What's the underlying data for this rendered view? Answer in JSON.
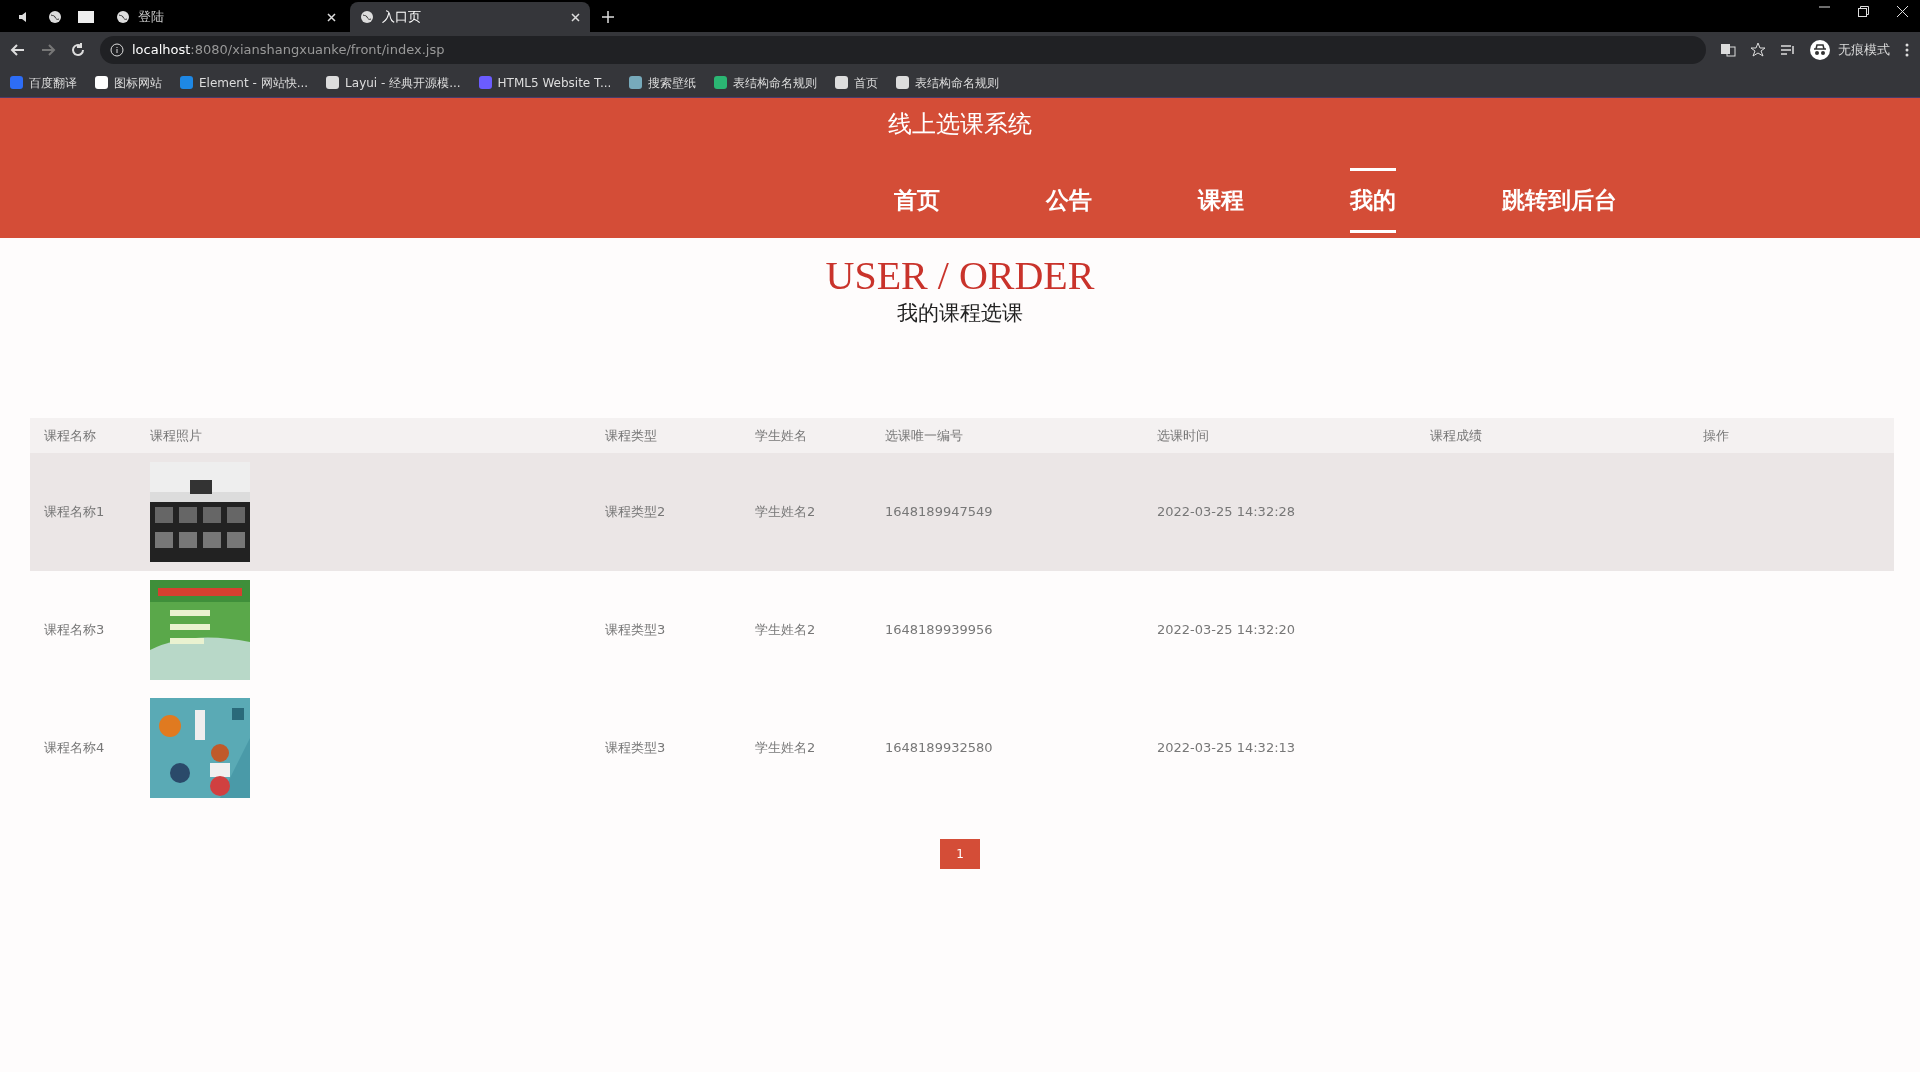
{
  "browser": {
    "tabs": [
      {
        "title": "登陆",
        "selected": false
      },
      {
        "title": "入口页",
        "selected": true
      }
    ],
    "url_host": "localhost",
    "url_path": ":8080/xianshangxuanke/front/index.jsp",
    "bookmarks": [
      "百度翻译",
      "图标网站",
      "Element - 网站快...",
      "Layui - 经典开源模...",
      "HTML5 Website T...",
      "搜索壁纸",
      "表结构命名规则",
      "首页",
      "表结构命名规则"
    ],
    "profile": "无痕模式"
  },
  "site": {
    "title": "线上选课系统",
    "nav": [
      {
        "label": "首页",
        "selected": false
      },
      {
        "label": "公告",
        "selected": false
      },
      {
        "label": "课程",
        "selected": false
      },
      {
        "label": "我的",
        "selected": true
      },
      {
        "label": "跳转到后台",
        "selected": false
      }
    ]
  },
  "page": {
    "title": "USER / ORDER",
    "subtitle": "我的课程选课"
  },
  "table": {
    "columns": [
      "课程名称",
      "课程照片",
      "课程类型",
      "学生姓名",
      "选课唯一编号",
      "选课时间",
      "课程成绩",
      "操作"
    ],
    "rows": [
      {
        "name": "课程名称1",
        "type": "课程类型2",
        "student": "学生姓名2",
        "number": "1648189947549",
        "time": "2022-03-25 14:32:28",
        "highlighted": true
      },
      {
        "name": "课程名称3",
        "type": "课程类型3",
        "student": "学生姓名2",
        "number": "1648189939956",
        "time": "2022-03-25 14:32:20",
        "highlighted": false
      },
      {
        "name": "课程名称4",
        "type": "课程类型3",
        "student": "学生姓名2",
        "number": "1648189932580",
        "time": "2022-03-25 14:32:13",
        "highlighted": false
      }
    ]
  },
  "pagination": [
    {
      "label": "1",
      "selected": true
    }
  ]
}
